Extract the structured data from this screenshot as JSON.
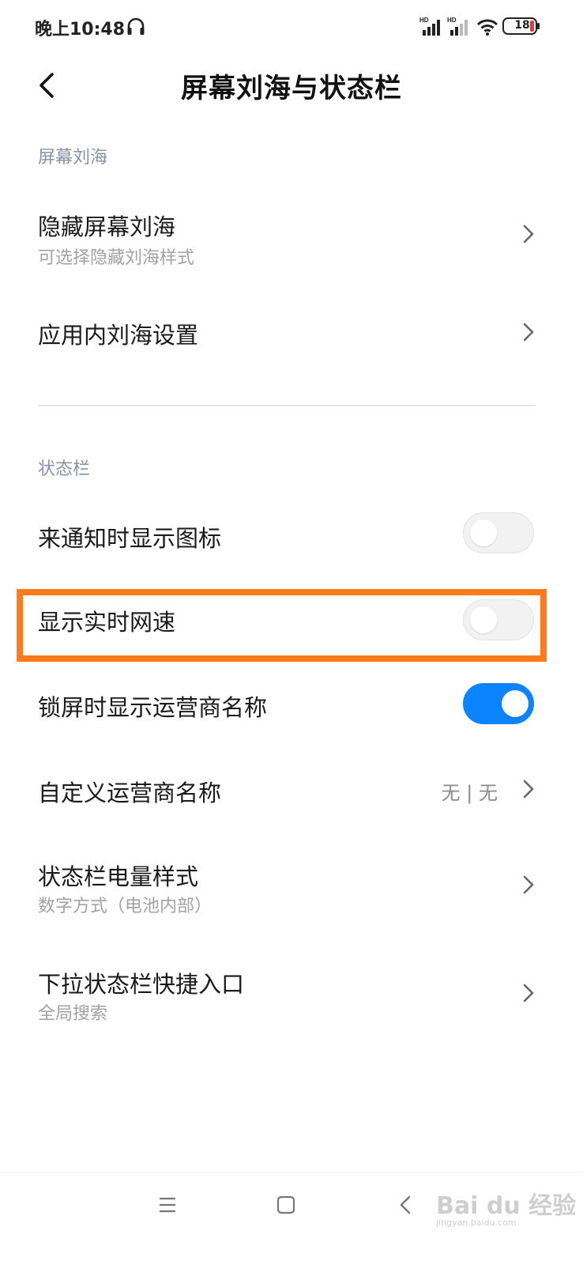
{
  "status_bar": {
    "time": "晚上10:48",
    "signal_label_1": "HD",
    "signal_label_2": "HD",
    "battery_level": "18",
    "icons": [
      "headphone-icon",
      "signal-icon",
      "signal-icon",
      "wifi-icon",
      "battery-icon"
    ]
  },
  "header": {
    "title": "屏幕刘海与状态栏",
    "back_icon": "chevron-left-icon"
  },
  "sections": {
    "notch_label": "屏幕刘海",
    "status_bar_label": "状态栏"
  },
  "rows": {
    "hide_notch": {
      "title": "隐藏屏幕刘海",
      "subtitle": "可选择隐藏刘海样式"
    },
    "in_app_notch": {
      "title": "应用内刘海设置"
    },
    "notify_icons": {
      "title": "来通知时显示图标",
      "toggle_on": false
    },
    "network_speed": {
      "title": "显示实时网速",
      "toggle_on": false
    },
    "carrier_lock": {
      "title": "锁屏时显示运营商名称",
      "toggle_on": true
    },
    "custom_carrier": {
      "title": "自定义运营商名称",
      "value": "无 | 无"
    },
    "battery_style": {
      "title": "状态栏电量样式",
      "subtitle": "数字方式（电池内部）"
    },
    "pulldown_shortcut": {
      "title": "下拉状态栏快捷入口",
      "subtitle": "全局搜索"
    }
  },
  "colors": {
    "accent": "#0d84ff",
    "highlight": "#ff7a1a",
    "section_label": "#8891a8"
  },
  "nav_bar": {
    "icons": [
      "menu-icon",
      "home-icon",
      "back-icon"
    ]
  },
  "watermark": {
    "text": "Bai du 经验",
    "subtext": "jingyan.baidu.com"
  }
}
